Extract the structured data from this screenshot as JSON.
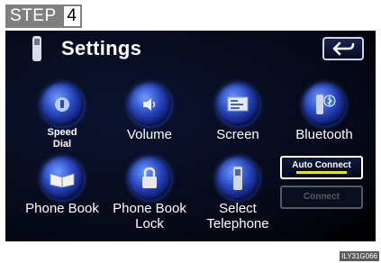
{
  "step": {
    "label": "STEP",
    "number": "4"
  },
  "header": {
    "title": "Settings"
  },
  "items": {
    "speed_dial": {
      "line1": "Speed",
      "line2": "Dial"
    },
    "volume": "Volume",
    "screen": "Screen",
    "bluetooth": "Bluetooth",
    "phone_book": "Phone Book",
    "phone_book_lock": {
      "line1": "Phone Book",
      "line2": "Lock"
    },
    "select_telephone": {
      "line1": "Select",
      "line2": "Telephone"
    }
  },
  "buttons": {
    "auto_connect": "Auto Connect",
    "connect": "Connect"
  },
  "figure_code": "ILY31G066",
  "icons": {
    "back": "back-arrow-icon",
    "phone": "cell-phone-icon",
    "speaker": "speaker-icon",
    "screen": "screen-icon",
    "bluetooth": "bluetooth-icon",
    "book": "book-icon",
    "lock": "lock-icon"
  },
  "colors": {
    "screen_bg": "#050815",
    "orb": "#2a49c0",
    "indicator": "#f2e600",
    "step_bg": "#808080"
  }
}
